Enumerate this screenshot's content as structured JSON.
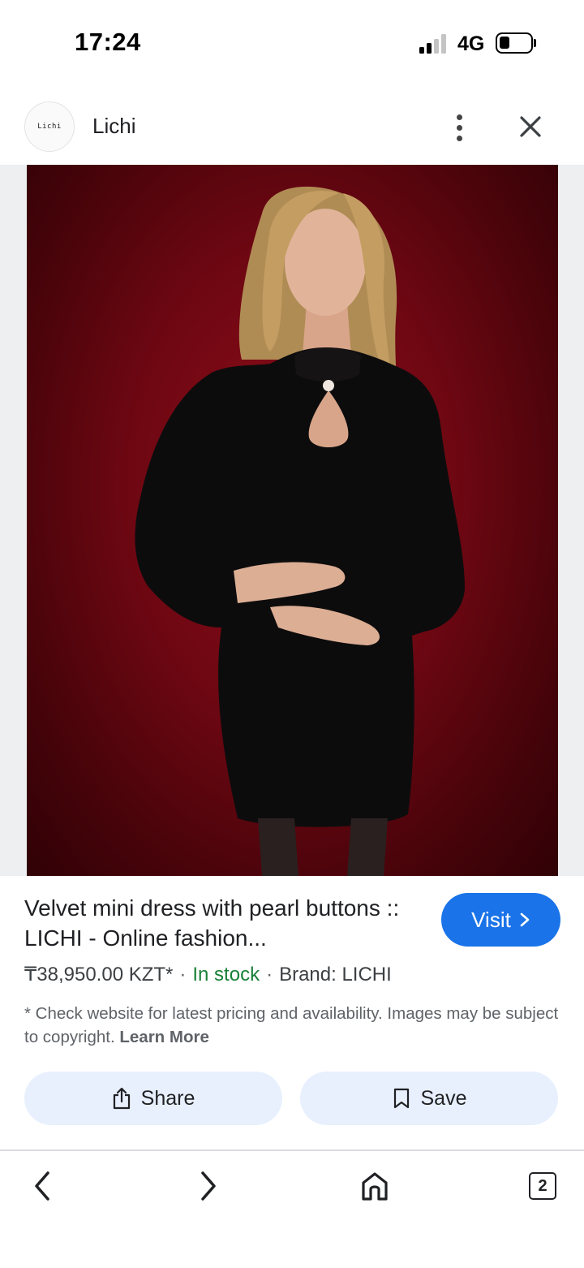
{
  "status_bar": {
    "time": "17:24",
    "network": "4G",
    "signal_bars_filled": 2,
    "signal_bars_total": 4
  },
  "header": {
    "logo_text": "Lichi",
    "site_name": "Lichi",
    "menu_icon": "more-vert-icon",
    "close_icon": "close-icon"
  },
  "product": {
    "image_alt": "Woman in black velvet mini dress with pearl button on dark red background",
    "title": "Velvet mini dress with pearl buttons :: LICHI - Online fashion...",
    "price": "₸38,950.00 KZT*",
    "separator": "·",
    "stock": "In stock",
    "brand": "Brand: LICHI",
    "disclaimer_text": "* Check website for latest pricing and availability. Images may be subject to copyright.",
    "learn_more": "Learn More"
  },
  "buttons": {
    "visit": "Visit",
    "share": "Share",
    "save": "Save"
  },
  "bottom_nav": {
    "tabs_count": "2"
  },
  "colors": {
    "accent": "#1a73e8",
    "stock_green": "#188038",
    "action_bg": "#e8f0fe",
    "image_bg": "#6c0712"
  }
}
